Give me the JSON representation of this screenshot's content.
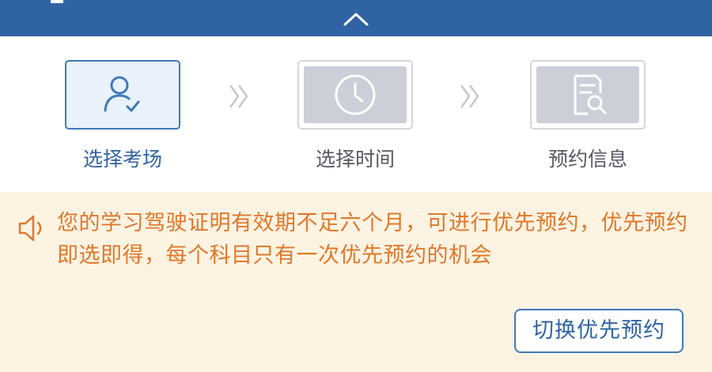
{
  "steps": [
    {
      "label": "选择考场",
      "icon": "user-check-icon",
      "state": "active"
    },
    {
      "label": "选择时间",
      "icon": "clock-icon",
      "state": "inactive"
    },
    {
      "label": "预约信息",
      "icon": "document-search-icon",
      "state": "inactive"
    }
  ],
  "notice": {
    "icon": "speaker-icon",
    "text": "您的学习驾驶证明有效期不足六个月，可进行优先预约，优先预约即选即得，每个科目只有一次优先预约的机会"
  },
  "actions": {
    "switch_label": "切换优先预约"
  },
  "colors": {
    "header": "#2f63a3",
    "accent": "#3f7ab8",
    "notice_bg": "#fdf3e3",
    "notice_text": "#e0782a",
    "inactive_icon_bg": "#cbcfd8"
  }
}
